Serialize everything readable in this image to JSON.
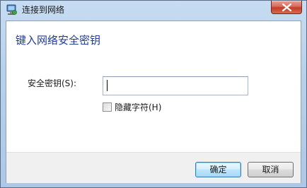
{
  "window": {
    "title": "连接到网络",
    "title_icon": "network-connect-icon",
    "close_icon": "close-icon"
  },
  "main": {
    "heading": "键入网络安全密钥",
    "key_label": "安全密钥(S):",
    "key_value": "",
    "hide_chars": {
      "label": "隐藏字符(H)",
      "checked": false
    }
  },
  "buttons": {
    "ok_label": "确定",
    "cancel_label": "取消"
  },
  "colors": {
    "heading": "#1e3c94",
    "close_button": "#c43c26",
    "window_frame": "#b7d0ea"
  }
}
